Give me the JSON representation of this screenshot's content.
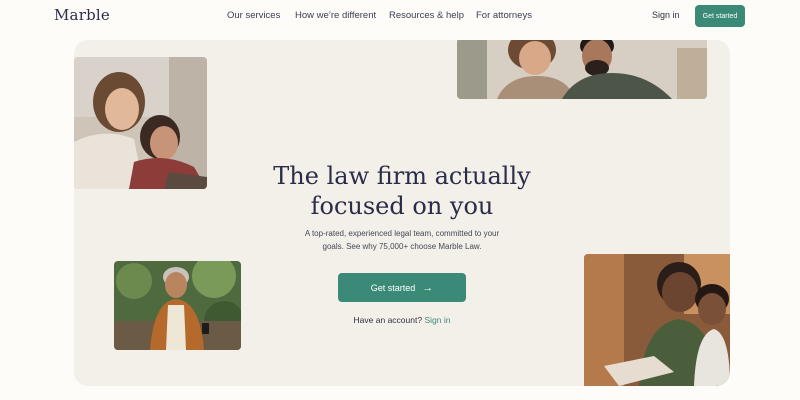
{
  "nav": {
    "logo": "Marble",
    "links": [
      "Our services",
      "How we’re different",
      "Resources & help",
      "For attorneys"
    ],
    "sign_in": "Sign in",
    "get_started": "Get started"
  },
  "hero": {
    "headline_line1": "The law firm actually",
    "headline_line2": "focused on you",
    "subtext_line1": "A top-rated, experienced legal team, committed to your",
    "subtext_line2": "goals. See why 75,000+ choose Marble Law.",
    "cta_label": "Get started",
    "account_prompt": "Have an account?",
    "account_link": "Sign in"
  },
  "colors": {
    "accent": "#3b8a78",
    "hero_bg": "#f3efe9",
    "page_bg": "#fdfcf9",
    "headline": "#2a2d48"
  }
}
